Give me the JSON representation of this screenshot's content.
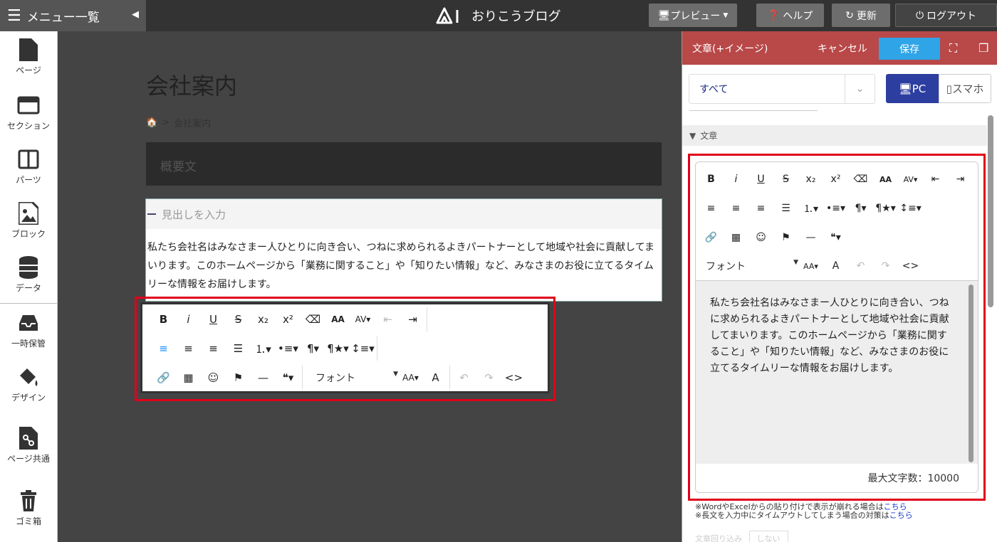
{
  "app": {
    "logo_text": "おりこうブログ"
  },
  "topbar": {
    "menu_label": "メニュー一覧",
    "preview": "プレビュー",
    "help": "ヘルプ",
    "update": "更新",
    "logout": "ログアウト"
  },
  "sidebar": {
    "items": [
      {
        "label": "ページ",
        "icon": "page-icon"
      },
      {
        "label": "セクション",
        "icon": "section-icon"
      },
      {
        "label": "パーツ",
        "icon": "parts-icon"
      },
      {
        "label": "ブロック",
        "icon": "block-icon"
      },
      {
        "label": "データ",
        "icon": "database-icon"
      },
      {
        "label": "一時保管",
        "icon": "inbox-icon"
      },
      {
        "label": "デザイン",
        "icon": "paint-bucket-icon"
      },
      {
        "label": "ページ共通",
        "icon": "shared-page-icon"
      },
      {
        "label": "ゴミ箱",
        "icon": "trash-icon"
      }
    ]
  },
  "page": {
    "title": "会社案内",
    "breadcrumb": "会社案内",
    "summary": "概要文",
    "heading_placeholder": "見出しを入力",
    "body": "私たち会社名はみなさまー人ひとりに向き合い、つねに求められるよきパートナーとして地域や社会に貢献してまいります。このホームページから「業務に関すること」や「知りたい情報」など、みなさまのお役に立てるタイムリーな情報をお届けします。"
  },
  "toolbar": {
    "font_label": "フォント"
  },
  "panel": {
    "title": "文章(+イメージ)",
    "cancel": "キャンセル",
    "save": "保存",
    "filter": "すべて",
    "device_pc": "PC",
    "device_phone": "スマホ",
    "section": "文章",
    "editor_text": "私たち会社名はみなさまー人ひとりに向き合い、つねに求められるよきパートナーとして地域や社会に貢献してまいります。このホームページから「業務に関すること」や「知りたい情報」など、みなさまのお役に立てるタイムリーな情報をお届けします。",
    "max_chars": "最大文字数：10000",
    "font_label": "フォント",
    "note1": "※WordやExcelからの貼り付けで表示が崩れる場合は",
    "note2": "※長文を入力中にタイムアウトしてしまう場合の対策は",
    "link": "こちら",
    "bottom_label": "文章回り込み",
    "bottom_select": "しない"
  },
  "colors": {
    "accent_red": "#e0001b",
    "panel_header": "#b94848",
    "save_blue": "#2fa4e7",
    "pc_active": "#2c3e9f"
  }
}
